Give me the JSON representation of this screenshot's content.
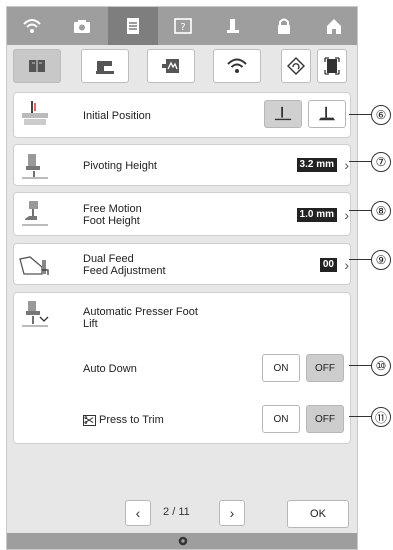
{
  "topbar": {
    "icons": [
      "wifi-icon",
      "camera-icon",
      "document-icon",
      "help-icon",
      "sewing-icon",
      "lock-icon",
      "home-icon"
    ],
    "active_index": 2
  },
  "category_tabs": {
    "icons": [
      "book-icon",
      "sewing-machine-icon",
      "embroidery-icon",
      "wifi-icon",
      "reset-icon",
      "frame-icon"
    ],
    "active_index": 0
  },
  "settings": {
    "initial_position": {
      "label": "Initial Position",
      "callout": "⑥"
    },
    "pivoting_height": {
      "label": "Pivoting Height",
      "value": "3.2 mm",
      "callout": "⑦"
    },
    "free_motion": {
      "label_line1": "Free Motion",
      "label_line2": "Foot Height",
      "value": "1.0 mm",
      "callout": "⑧"
    },
    "dual_feed": {
      "label_line1": "Dual Feed",
      "label_line2": "Feed Adjustment",
      "value": "00",
      "callout": "⑨"
    },
    "auto_lift": {
      "label_line1": "Automatic Presser Foot",
      "label_line2": "Lift",
      "auto_down": {
        "label": "Auto Down",
        "on": "ON",
        "off": "OFF",
        "callout": "⑩"
      },
      "press_to_trim": {
        "label": "Press to Trim",
        "on": "ON",
        "off": "OFF",
        "callout": "⑪"
      }
    }
  },
  "pager": {
    "current": "2",
    "separator": "/",
    "total": "11",
    "ok": "OK"
  },
  "colors": {
    "accent": "#9e9e9e",
    "selected": "#cdcdcd",
    "value_bg": "#222222"
  }
}
